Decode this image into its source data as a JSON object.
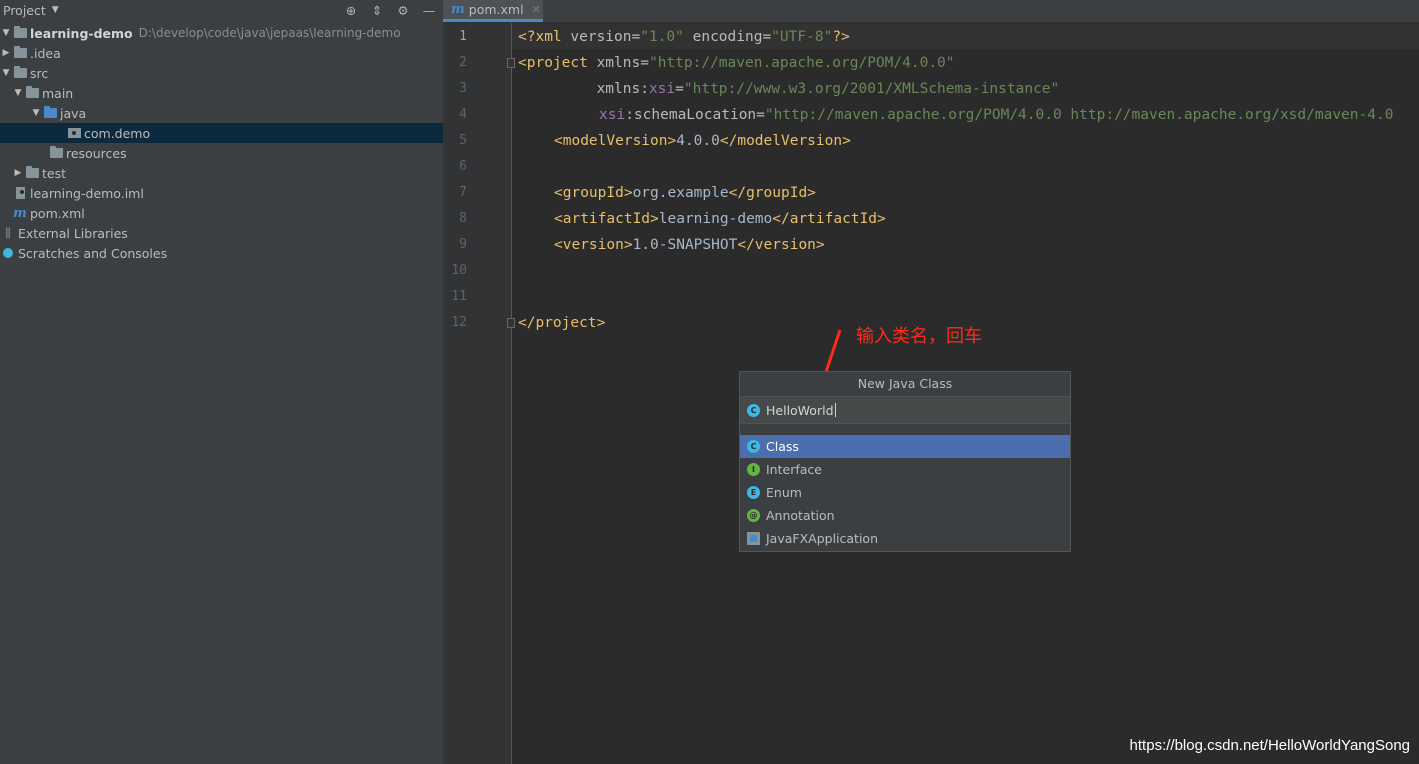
{
  "sidebar": {
    "header": {
      "title": "Project"
    },
    "tree": [
      {
        "label": "learning-demo",
        "path": "D:\\develop\\code\\java\\jepaas\\learning-demo"
      },
      {
        "label": ".idea"
      },
      {
        "label": "src"
      },
      {
        "label": "main"
      },
      {
        "label": "java"
      },
      {
        "label": "com.demo"
      },
      {
        "label": "resources"
      },
      {
        "label": "test"
      },
      {
        "label": "learning-demo.iml"
      },
      {
        "label": "pom.xml"
      },
      {
        "label": "External Libraries"
      },
      {
        "label": "Scratches and Consoles"
      }
    ]
  },
  "editor": {
    "tab": {
      "label": "pom.xml"
    },
    "line_numbers": [
      "1",
      "2",
      "3",
      "4",
      "5",
      "6",
      "7",
      "8",
      "9",
      "10",
      "11",
      "12"
    ],
    "lines": {
      "l1": {
        "a": "<?xml ",
        "b": "version",
        "c": "=",
        "d": "\"1.0\"",
        "e": " encoding",
        "f": "=",
        "g": "\"UTF-8\"",
        "h": "?>"
      },
      "l2": {
        "a": "<project ",
        "b": "xmlns",
        "c": "=",
        "d": "\"http://maven.apache.org/POM/4.0.0\""
      },
      "l3": {
        "a": "         xmlns:",
        "b": "xsi",
        "c": "=",
        "d": "\"http://www.w3.org/2001/XMLSchema-instance\""
      },
      "l4": {
        "a": "xsi",
        "b": ":schemaLocation",
        "c": "=",
        "d": "\"http://maven.apache.org/POM/4.0.0 http://maven.apache.org/xsd/maven-4.0"
      },
      "l5": {
        "open": "<modelVersion>",
        "text": "4.0.0",
        "close": "</modelVersion>"
      },
      "l7": {
        "open": "<groupId>",
        "text": "org.example",
        "close": "</groupId>"
      },
      "l8": {
        "open": "<artifactId>",
        "text": "learning-demo",
        "close": "</artifactId>"
      },
      "l9": {
        "open": "<version>",
        "text": "1.0-SNAPSHOT",
        "close": "</version>"
      },
      "l12": {
        "close": "</project>"
      }
    }
  },
  "annotation": {
    "text": "输入类名，回车"
  },
  "dialog": {
    "title": "New Java Class",
    "input_value": "HelloWorld",
    "options": [
      {
        "label": "Class",
        "icon": "C"
      },
      {
        "label": "Interface",
        "icon": "I"
      },
      {
        "label": "Enum",
        "icon": "E"
      },
      {
        "label": "Annotation",
        "icon": "@"
      },
      {
        "label": "JavaFXApplication",
        "icon": ""
      }
    ]
  },
  "watermark": {
    "text": "https://blog.csdn.net/HelloWorldYangSong"
  },
  "colors": {
    "selection": "#4b6eaf",
    "annotation": "#ff2a1a",
    "tag": "#e8bf6a",
    "string": "#6a8759"
  }
}
